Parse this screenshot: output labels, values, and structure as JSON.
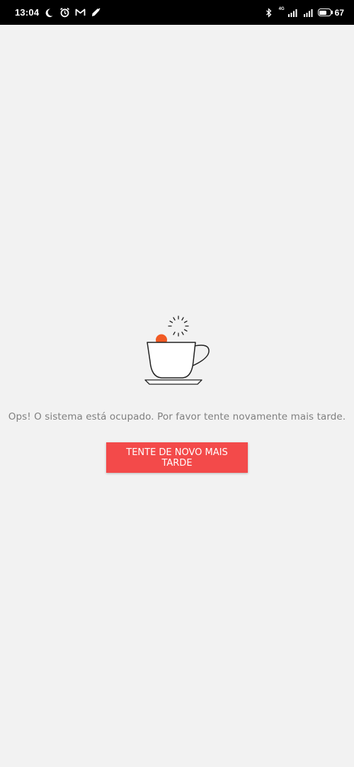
{
  "status_bar": {
    "time": "13:04",
    "network_label": "4G",
    "battery_percent": "67",
    "battery_level": 0.67,
    "icons_left": [
      "moon-icon",
      "alarm-icon",
      "gmail-icon",
      "app-notification-icon"
    ],
    "icons_right": [
      "bluetooth-icon",
      "signal-icon",
      "signal-icon",
      "battery-icon"
    ]
  },
  "error_screen": {
    "illustration": "coffee-cup-icon",
    "message": "Ops! O sistema está ocupado. Por favor tente novamente mais tarde.",
    "retry_button_label": "TENTE DE NOVO MAIS TARDE"
  },
  "colors": {
    "background": "#f2f2f2",
    "status_bar": "#000000",
    "button": "#f34a4a",
    "accent_dot": "#f15a24",
    "message_text": "#7f7f7f"
  }
}
